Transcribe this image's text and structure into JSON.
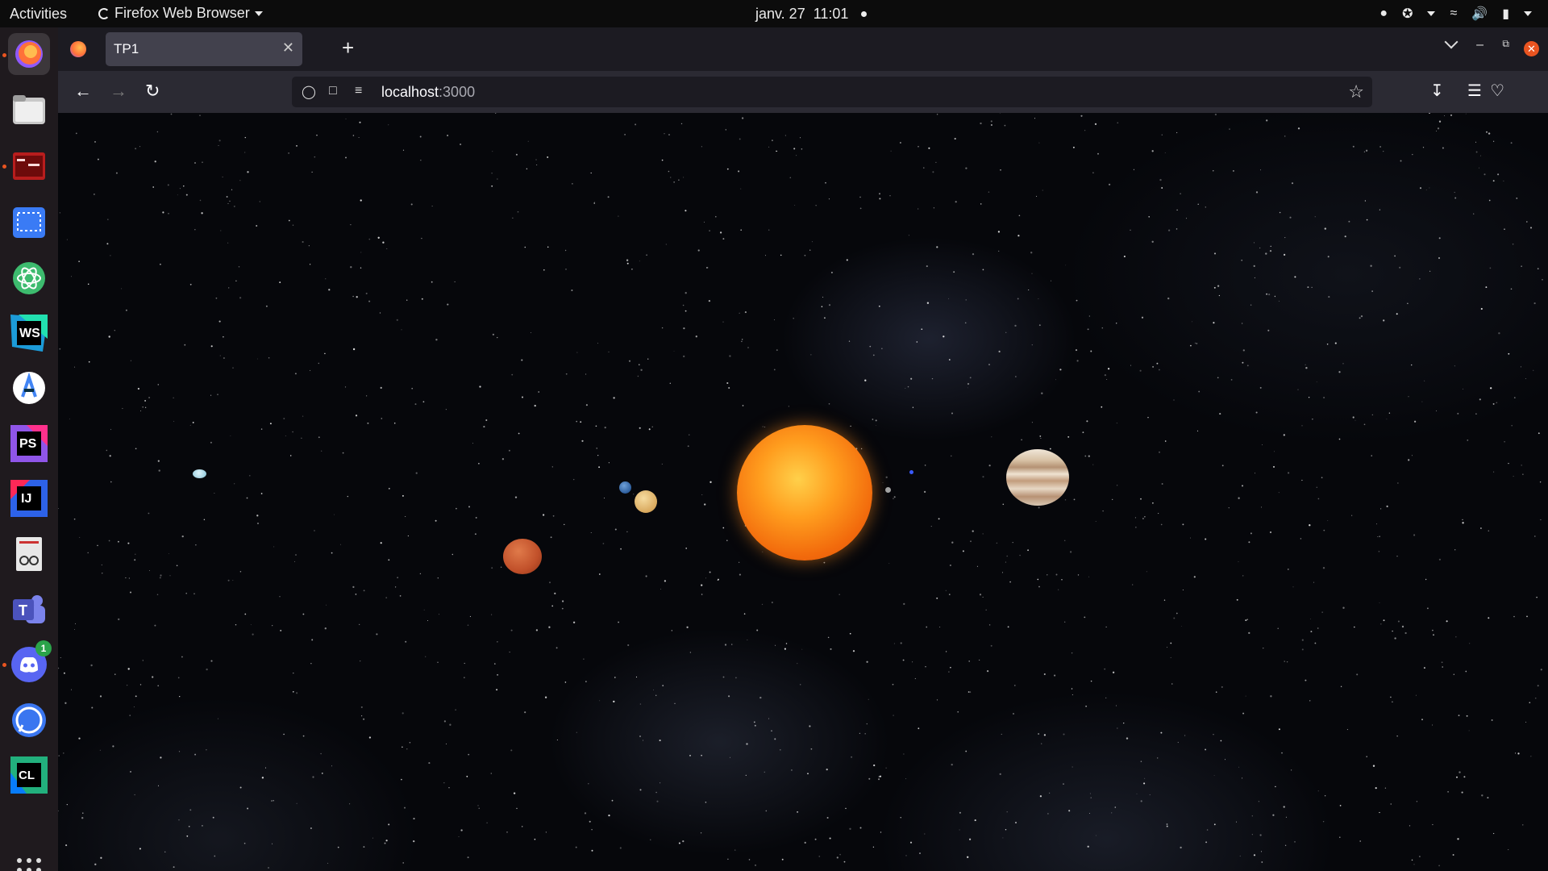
{
  "topbar": {
    "activities": "Activities",
    "app_name": "Firefox Web Browser",
    "date": "janv. 27",
    "time": "11:01"
  },
  "dock": {
    "items": [
      {
        "name": "firefox-icon",
        "color": "#ff7139"
      },
      {
        "name": "files-icon",
        "color": "#c9c9c9"
      },
      {
        "name": "terminal-icon",
        "color": "#b81d1d"
      },
      {
        "name": "screenshot-icon",
        "color": "#3a7bf5"
      },
      {
        "name": "atom-icon",
        "color": "#3dbb6e"
      },
      {
        "name": "webstorm-icon",
        "color": "#1c9bd8",
        "text": "WS"
      },
      {
        "name": "android-studio-icon",
        "color": "#4285f4"
      },
      {
        "name": "phpstorm-icon",
        "color": "#8f55e8",
        "text": "PS"
      },
      {
        "name": "intellij-icon",
        "color": "#2d62e8",
        "text": "IJ"
      },
      {
        "name": "document-viewer-icon",
        "color": "#e8e8e8"
      },
      {
        "name": "teams-icon",
        "color": "#5b5fc7",
        "text": "T"
      },
      {
        "name": "discord-icon",
        "color": "#5865f2",
        "badge": "1"
      },
      {
        "name": "signal-icon",
        "color": "#3a76f0"
      },
      {
        "name": "clion-icon",
        "color": "#22b07d",
        "text": "CL"
      }
    ]
  },
  "browser": {
    "tab_title": "TP1",
    "url_host": "localhost",
    "url_port": ":3000"
  },
  "scene": {
    "bodies": [
      {
        "name": "sun",
        "color": "#ff7a10"
      },
      {
        "name": "jupiter",
        "color": "#d8c8b0"
      },
      {
        "name": "mars",
        "color": "#c9542e"
      },
      {
        "name": "venus",
        "color": "#e8c27a"
      },
      {
        "name": "earth",
        "color": "#3a6fb0"
      },
      {
        "name": "mercury",
        "color": "#a0a0a0"
      },
      {
        "name": "small-blue-moon",
        "color": "#3a5aff"
      },
      {
        "name": "uranus",
        "color": "#b4e0ee"
      }
    ]
  }
}
